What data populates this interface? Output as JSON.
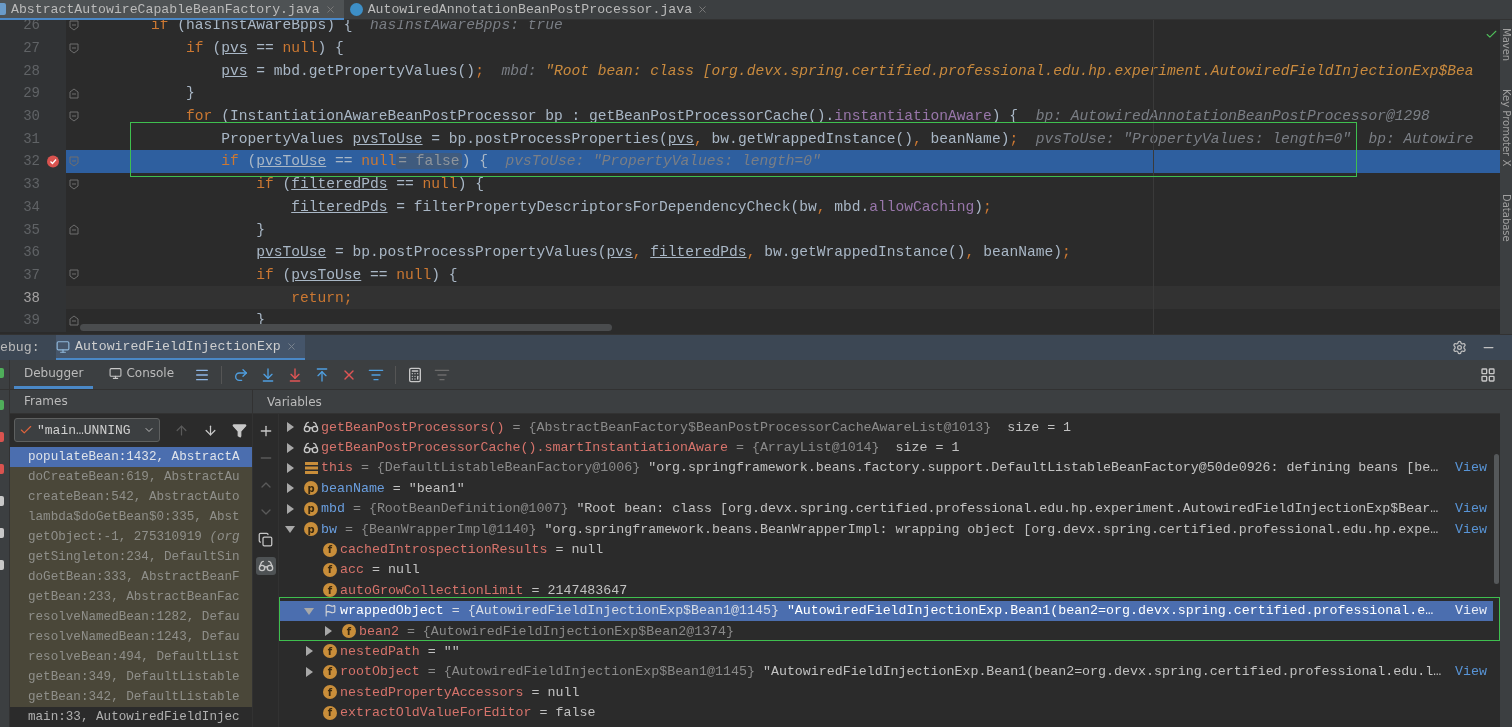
{
  "editor_tabs": [
    {
      "label": "AbstractAutowireCapableBeanFactory.java",
      "selected": true
    },
    {
      "label": "AutowiredAnnotationBeanPostProcessor.java",
      "selected": false
    }
  ],
  "editor": {
    "lines": [
      {
        "number": "26",
        "fold_start": true,
        "fold_end": false,
        "breakpoint": false,
        "execution": false,
        "current": false,
        "tokens": [
          {
            "t": "        if",
            "kind": "kw"
          },
          {
            "t": " (hasInstAwareBpps) {",
            "kind": "id"
          },
          {
            "t": "  hasInstAwareBpps: true",
            "kind": "hint"
          }
        ]
      },
      {
        "number": "27",
        "fold_start": true,
        "fold_end": false,
        "breakpoint": false,
        "execution": false,
        "current": false,
        "tokens": [
          {
            "t": "            if",
            "kind": "kw"
          },
          {
            "t": " (",
            "kind": "id"
          },
          {
            "t": "pvs",
            "kind": "var"
          },
          {
            "t": " == ",
            "kind": "id"
          },
          {
            "t": "null",
            "kind": "kw"
          },
          {
            "t": ") {",
            "kind": "id"
          }
        ]
      },
      {
        "number": "28",
        "fold_start": false,
        "fold_end": false,
        "breakpoint": false,
        "execution": false,
        "current": false,
        "tokens": [
          {
            "t": "                pvs",
            "kind": "var"
          },
          {
            "t": " = mbd.getPropertyValues()",
            "kind": "id"
          },
          {
            "t": ";",
            "kind": "sep"
          },
          {
            "t": "  mbd: ",
            "kind": "hint"
          },
          {
            "t": "\"Root bean: class [org.devx.spring.certified.professional.edu.hp.experiment.AutowiredFieldInjectionExp$Bea",
            "kind": "hintstr"
          }
        ]
      },
      {
        "number": "29",
        "fold_start": false,
        "fold_end": true,
        "breakpoint": false,
        "execution": false,
        "current": false,
        "tokens": [
          {
            "t": "            }",
            "kind": "id"
          }
        ]
      },
      {
        "number": "30",
        "fold_start": true,
        "fold_end": false,
        "breakpoint": false,
        "execution": false,
        "current": false,
        "tokens": [
          {
            "t": "            for",
            "kind": "kw"
          },
          {
            "t": " (InstantiationAwareBeanPostProcessor bp : getBeanPostProcessorCache().",
            "kind": "id"
          },
          {
            "t": "instantiationAware",
            "kind": "field"
          },
          {
            "t": ") {",
            "kind": "id"
          },
          {
            "t": "  bp: AutowiredAnnotationBeanPostProcessor@1298",
            "kind": "hint"
          }
        ]
      },
      {
        "number": "31",
        "fold_start": false,
        "fold_end": false,
        "breakpoint": false,
        "execution": false,
        "current": false,
        "tokens": [
          {
            "t": "                PropertyValues ",
            "kind": "id"
          },
          {
            "t": "pvsToUse",
            "kind": "var"
          },
          {
            "t": " = bp.postProcessProperties(",
            "kind": "id"
          },
          {
            "t": "pvs",
            "kind": "var"
          },
          {
            "t": ",",
            "kind": "sep"
          },
          {
            "t": " bw.getWrappedInstance()",
            "kind": "id"
          },
          {
            "t": ",",
            "kind": "sep"
          },
          {
            "t": " beanName)",
            "kind": "id"
          },
          {
            "t": ";",
            "kind": "sep"
          },
          {
            "t": "  pvsToUse: \"PropertyValues: length=0\"  bp: Autowire",
            "kind": "hint"
          }
        ]
      },
      {
        "number": "32",
        "fold_start": true,
        "fold_end": false,
        "breakpoint": true,
        "execution": true,
        "current": false,
        "tokens": [
          {
            "t": "                if",
            "kind": "kw"
          },
          {
            "t": " (",
            "kind": "id"
          },
          {
            "t": "pvsToUse",
            "kind": "var"
          },
          {
            "t": " == ",
            "kind": "id"
          },
          {
            "t": "null",
            "kind": "kw"
          },
          {
            "t": "= false",
            "kind": "badge"
          },
          {
            "t": ") {",
            "kind": "id"
          },
          {
            "t": "  pvsToUse: \"PropertyValues: length=0\"",
            "kind": "hint"
          }
        ]
      },
      {
        "number": "33",
        "fold_start": true,
        "fold_end": false,
        "breakpoint": false,
        "execution": false,
        "current": false,
        "tokens": [
          {
            "t": "                    if",
            "kind": "kw"
          },
          {
            "t": " (",
            "kind": "id"
          },
          {
            "t": "filteredPds",
            "kind": "var"
          },
          {
            "t": " == ",
            "kind": "id"
          },
          {
            "t": "null",
            "kind": "kw"
          },
          {
            "t": ") {",
            "kind": "id"
          }
        ]
      },
      {
        "number": "34",
        "fold_start": false,
        "fold_end": false,
        "breakpoint": false,
        "execution": false,
        "current": false,
        "tokens": [
          {
            "t": "                        filteredPds",
            "kind": "var"
          },
          {
            "t": " = filterPropertyDescriptorsForDependencyCheck(bw",
            "kind": "id"
          },
          {
            "t": ",",
            "kind": "sep"
          },
          {
            "t": " mbd.",
            "kind": "id"
          },
          {
            "t": "allowCaching",
            "kind": "field"
          },
          {
            "t": ")",
            "kind": "id"
          },
          {
            "t": ";",
            "kind": "sep"
          }
        ]
      },
      {
        "number": "35",
        "fold_start": false,
        "fold_end": true,
        "breakpoint": false,
        "execution": false,
        "current": false,
        "tokens": [
          {
            "t": "                    }",
            "kind": "id"
          }
        ]
      },
      {
        "number": "36",
        "fold_start": false,
        "fold_end": false,
        "breakpoint": false,
        "execution": false,
        "current": false,
        "tokens": [
          {
            "t": "                    pvsToUse",
            "kind": "var"
          },
          {
            "t": " = bp.postProcessPropertyValues(",
            "kind": "id"
          },
          {
            "t": "pvs",
            "kind": "var"
          },
          {
            "t": ", ",
            "kind": "sep"
          },
          {
            "t": "filteredPds",
            "kind": "var"
          },
          {
            "t": ",",
            "kind": "sep"
          },
          {
            "t": " bw.getWrappedInstance()",
            "kind": "id"
          },
          {
            "t": ",",
            "kind": "sep"
          },
          {
            "t": " beanName)",
            "kind": "id"
          },
          {
            "t": ";",
            "kind": "sep"
          }
        ]
      },
      {
        "number": "37",
        "fold_start": true,
        "fold_end": false,
        "breakpoint": false,
        "execution": false,
        "current": false,
        "tokens": [
          {
            "t": "                    if",
            "kind": "kw"
          },
          {
            "t": " (",
            "kind": "id"
          },
          {
            "t": "pvsToUse",
            "kind": "var"
          },
          {
            "t": " == ",
            "kind": "id"
          },
          {
            "t": "null",
            "kind": "kw"
          },
          {
            "t": ") {",
            "kind": "id"
          }
        ]
      },
      {
        "number": "38",
        "fold_start": false,
        "fold_end": false,
        "breakpoint": false,
        "execution": false,
        "current": true,
        "tokens": [
          {
            "t": "                        return",
            "kind": "kw"
          },
          {
            "t": ";",
            "kind": "sep"
          }
        ]
      },
      {
        "number": "39",
        "fold_start": false,
        "fold_end": true,
        "breakpoint": false,
        "execution": false,
        "current": false,
        "tokens": [
          {
            "t": "                    }",
            "kind": "id"
          }
        ]
      }
    ]
  },
  "right_strip": [
    "Maven",
    "Key Promoter X",
    "Database"
  ],
  "debug": {
    "title": "ebug:",
    "session_tab": "AutowiredFieldInjectionExp",
    "tabs": [
      {
        "label": "Debugger",
        "selected": true
      },
      {
        "label": "Console",
        "selected": false
      }
    ],
    "frames": {
      "title": "Frames",
      "thread": "\"main…UNNING",
      "items": [
        {
          "label": "populateBean:1432, AbstractA",
          "selected": true,
          "library": true
        },
        {
          "label": "doCreateBean:619, AbstractAu",
          "selected": false,
          "library": true
        },
        {
          "label": "createBean:542, AbstractAuto",
          "selected": false,
          "library": true
        },
        {
          "label": "lambda$doGetBean$0:335, Abst",
          "selected": false,
          "library": true
        },
        {
          "label": "getObject:-1, 275310919 *(org*",
          "selected": false,
          "library": true
        },
        {
          "label": "getSingleton:234, DefaultSin",
          "selected": false,
          "library": true
        },
        {
          "label": "doGetBean:333, AbstractBeanF",
          "selected": false,
          "library": true
        },
        {
          "label": "getBean:233, AbstractBeanFac",
          "selected": false,
          "library": true
        },
        {
          "label": "resolveNamedBean:1282, Defau",
          "selected": false,
          "library": true
        },
        {
          "label": "resolveNamedBean:1243, Defau",
          "selected": false,
          "library": true
        },
        {
          "label": "resolveBean:494, DefaultList",
          "selected": false,
          "library": true
        },
        {
          "label": "getBean:349, DefaultListable",
          "selected": false,
          "library": true
        },
        {
          "label": "getBean:342, DefaultListable",
          "selected": false,
          "library": true
        },
        {
          "label": "main:33, AutowiredFieldInjec",
          "selected": false,
          "library": false
        }
      ]
    },
    "variables": {
      "title": "Variables",
      "rows": [
        {
          "kind": "watch",
          "name": "getBeanPostProcessors()",
          "type": "= {AbstractBeanFactory$BeanPostProcessorCacheAwareList@1013}",
          "extra": "size = 1",
          "expanded": false,
          "selected": false
        },
        {
          "kind": "watch",
          "name": "getBeanPostProcessorCache().smartInstantiationAware",
          "type": "= {ArrayList@1014}",
          "extra": "size = 1",
          "expanded": false,
          "selected": false
        },
        {
          "kind": "local",
          "name": "this",
          "type": "= {DefaultListableBeanFactory@1006}",
          "value": "\"org.springframework.beans.factory.support.DefaultListableBeanFactory@50de0926: defining beans [be…",
          "view": "View",
          "expanded": false,
          "selected": false
        },
        {
          "kind": "param",
          "badge": "p",
          "name": "beanName",
          "value": "= \"bean1\"",
          "expanded": false,
          "selected": false
        },
        {
          "kind": "param",
          "badge": "p",
          "name": "mbd",
          "type": "= {RootBeanDefinition@1007}",
          "value": "\"Root bean: class [org.devx.spring.certified.professional.edu.hp.experiment.AutowiredFieldInjectionExp$Bear…",
          "view": "View",
          "expanded": false,
          "selected": false
        },
        {
          "kind": "param",
          "badge": "p",
          "name": "bw",
          "type": "= {BeanWrapperImpl@1140}",
          "value": "\"org.springframework.beans.BeanWrapperImpl: wrapping object [org.devx.spring.certified.professional.edu.hp.expe…",
          "view": "View",
          "expanded": true,
          "selected": false,
          "children": [
            {
              "kind": "field",
              "badge": "f",
              "name": "cachedIntrospectionResults",
              "value": "= null",
              "selected": false
            },
            {
              "kind": "field",
              "badge": "f",
              "name": "acc",
              "value": "= null",
              "selected": false
            },
            {
              "kind": "field",
              "badge": "f",
              "name": "autoGrowCollectionLimit",
              "value": "= 2147483647",
              "selected": false
            },
            {
              "kind": "marked",
              "name": "wrappedObject",
              "type": "= {AutowiredFieldInjectionExp$Bean1@1145}",
              "value": "\"AutowiredFieldInjectionExp.Bean1(bean2=org.devx.spring.certified.professional.e…",
              "view": "View",
              "expanded": true,
              "selected": true,
              "children": [
                {
                  "kind": "field",
                  "badge": "f",
                  "name": "bean2",
                  "type": "= {AutowiredFieldInjectionExp$Bean2@1374}",
                  "expanded": false,
                  "selected": false
                }
              ]
            },
            {
              "kind": "field",
              "badge": "f",
              "name": "nestedPath",
              "value": "= \"\"",
              "expanded": false,
              "selected": false
            },
            {
              "kind": "field",
              "badge": "f",
              "name": "rootObject",
              "type": "= {AutowiredFieldInjectionExp$Bean1@1145}",
              "value": "\"AutowiredFieldInjectionExp.Bean1(bean2=org.devx.spring.certified.professional.edu.l…",
              "view": "View",
              "expanded": false,
              "selected": false
            },
            {
              "kind": "field",
              "badge": "f",
              "name": "nestedPropertyAccessors",
              "value": "= null",
              "selected": false
            },
            {
              "kind": "field",
              "badge": "f",
              "name": "extractOldValueForEditor",
              "value": "= false",
              "selected": false
            }
          ]
        }
      ]
    }
  }
}
